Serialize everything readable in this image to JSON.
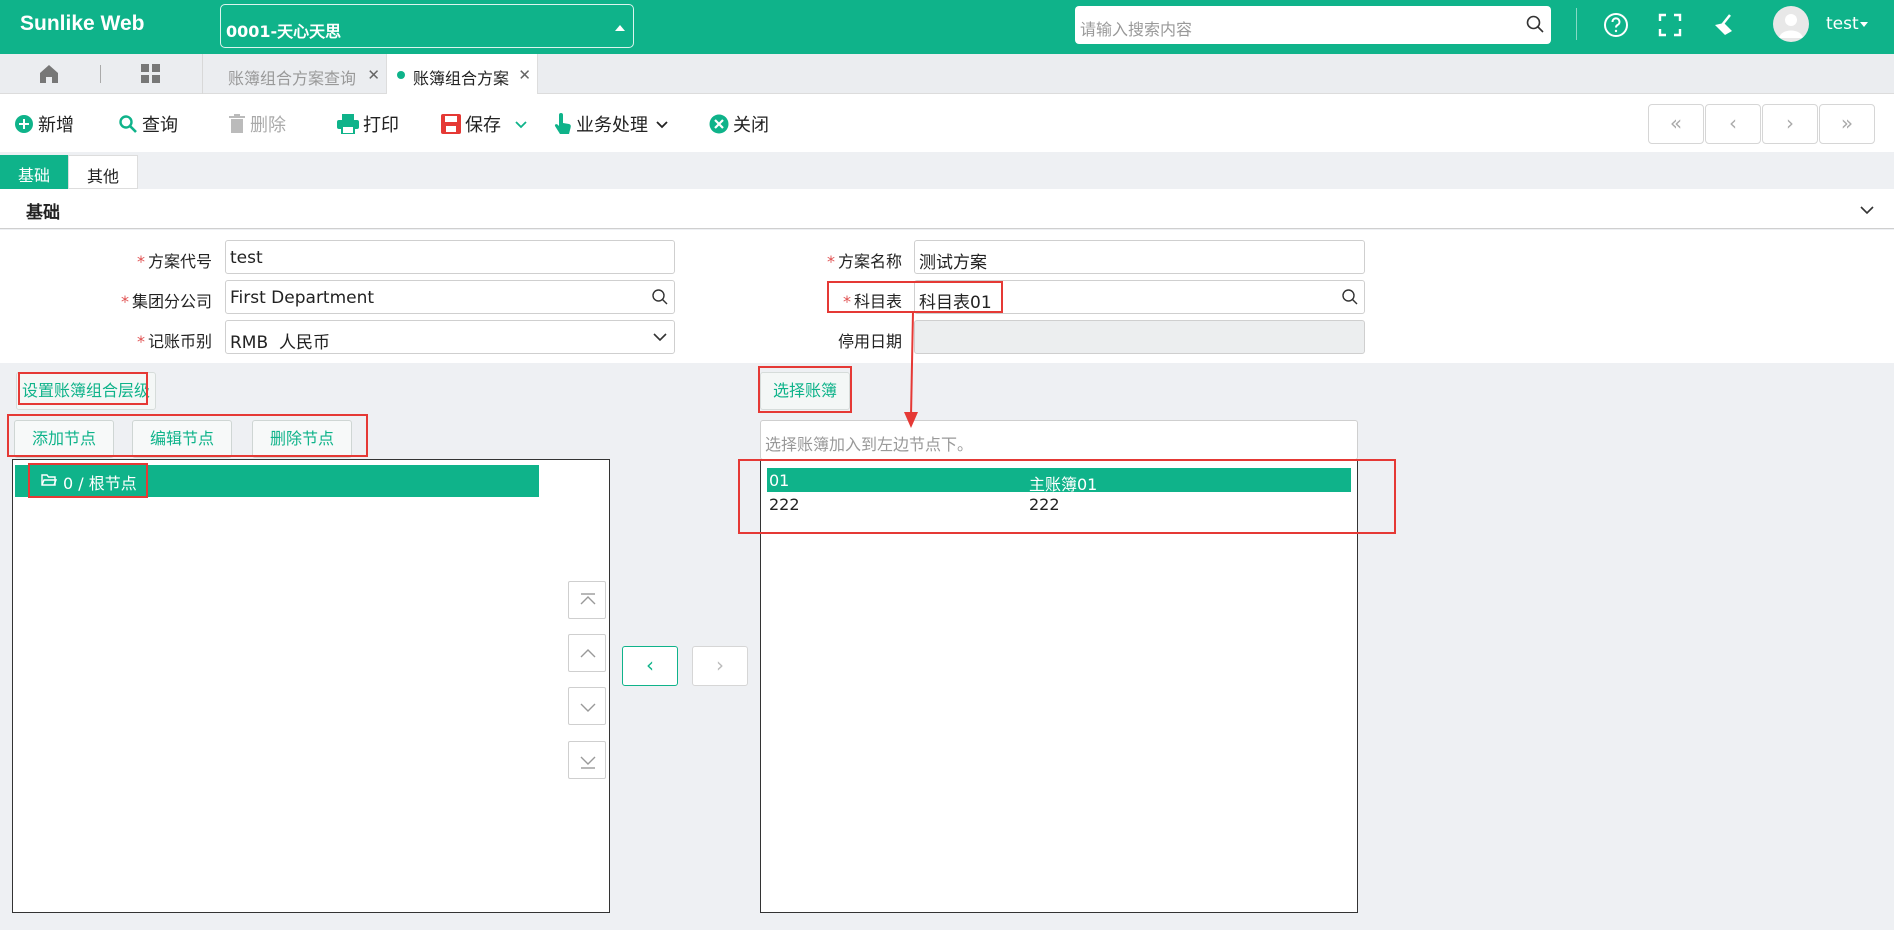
{
  "header": {
    "logo": "Sunlike Web",
    "company": "0001-天心天思",
    "search_placeholder": "请输入搜索内容",
    "user": "test"
  },
  "tabs": [
    {
      "label": "账簿组合方案查询"
    },
    {
      "label": "账簿组合方案"
    }
  ],
  "toolbar": {
    "add": "新增",
    "query": "查询",
    "delete": "删除",
    "print": "打印",
    "save": "保存",
    "business": "业务处理",
    "close": "关闭"
  },
  "form_tabs": [
    "基础",
    "其他"
  ],
  "section_title": "基础",
  "form": {
    "code_label": "方案代号",
    "code_value": "test",
    "name_label": "方案名称",
    "name_value": "测试方案",
    "company_label": "集团分公司",
    "company_value": "First Department",
    "account_label": "科目表",
    "account_value": "科目表01",
    "currency_label": "记账币别",
    "currency_value": "RMB  人民币",
    "disable_label": "停用日期",
    "disable_value": ""
  },
  "left_panel": {
    "set_level": "设置账簿组合层级",
    "add_node": "添加节点",
    "edit_node": "编辑节点",
    "delete_node": "删除节点",
    "root_node": "0 / 根节点"
  },
  "right_panel": {
    "select_books": "选择账簿",
    "placeholder": "选择账簿加入到左边节点下。",
    "rows": [
      {
        "code": "01",
        "name": "主账簿01"
      },
      {
        "code": "222",
        "name": "222"
      }
    ]
  },
  "colors": {
    "primary": "#0fb38a",
    "annotation": "#e53935",
    "required": "#e05050"
  }
}
